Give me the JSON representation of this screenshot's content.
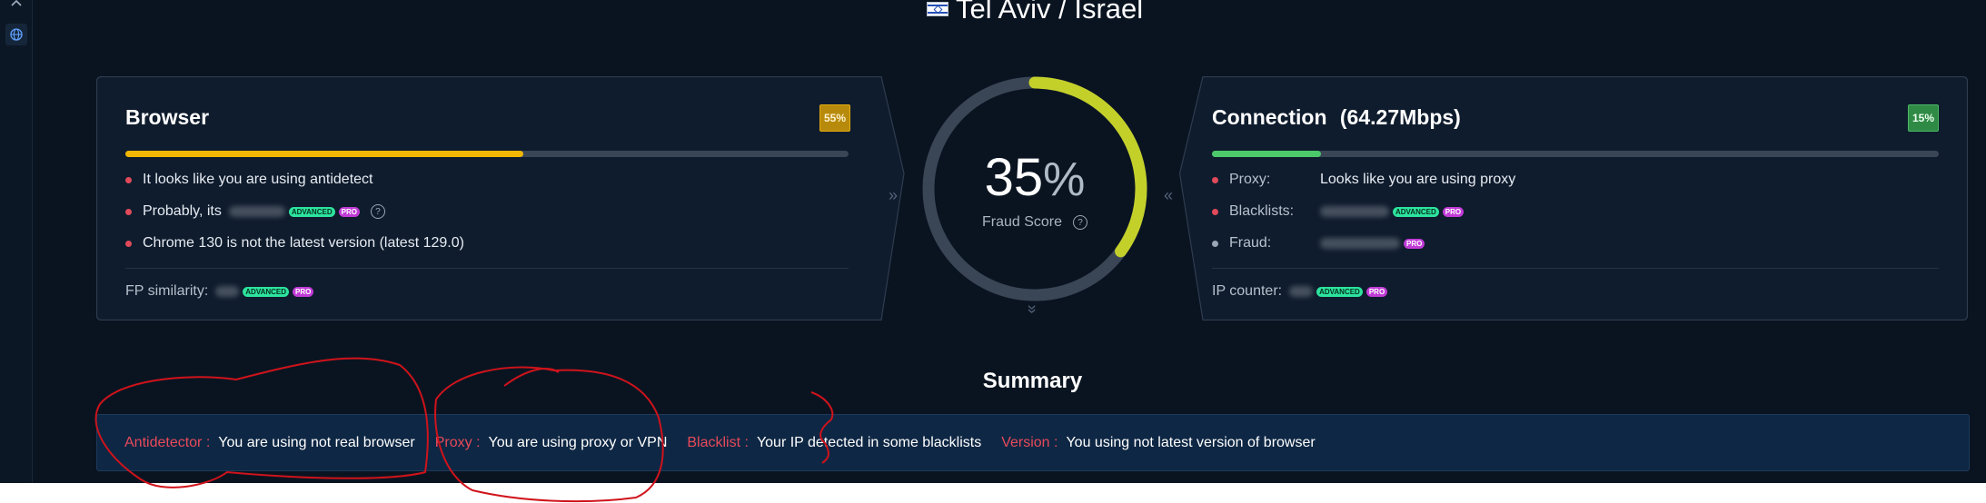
{
  "header": {
    "location": "Tel Aviv / Israel",
    "flag_icon": "israel-flag-icon"
  },
  "sidebar": {
    "icons": [
      "close-icon",
      "globe-icon"
    ]
  },
  "browser": {
    "title": "Browser",
    "badge": "55%",
    "progress": 0.55,
    "colors": {
      "bar": "#f2b705",
      "badge_bg": "#b88a0b"
    },
    "items": [
      "It looks like you are using antidetect",
      "Probably, its",
      "Chrome 130 is not the latest version (latest 129.0)"
    ],
    "tags": {
      "advanced": "ADVANCED",
      "pro": "PRO"
    },
    "footer_label": "FP similarity:"
  },
  "gauge": {
    "value": "35",
    "percent_sign": "%",
    "label": "Fraud Score",
    "fraction": 0.35,
    "color": "#c4d02a"
  },
  "connection": {
    "title": "Connection",
    "speed": "(64.27Mbps)",
    "badge": "15%",
    "progress": 0.15,
    "colors": {
      "bar": "#4cc96a",
      "badge_bg": "#2f8a45"
    },
    "rows": [
      {
        "label": "Proxy:",
        "value": "Looks like you are using proxy"
      },
      {
        "label": "Blacklists:"
      },
      {
        "label": "Fraud:"
      }
    ],
    "footer_label": "IP counter:"
  },
  "summary": {
    "title": "Summary",
    "items": [
      {
        "key": "Antidetector :",
        "value": "You are using not real browser"
      },
      {
        "key": "Proxy :",
        "value": "You are using proxy or VPN"
      },
      {
        "key": "Blacklist :",
        "value": "Your IP detected in some blacklists"
      },
      {
        "key": "Version :",
        "value": "You using not latest version of browser"
      }
    ]
  }
}
